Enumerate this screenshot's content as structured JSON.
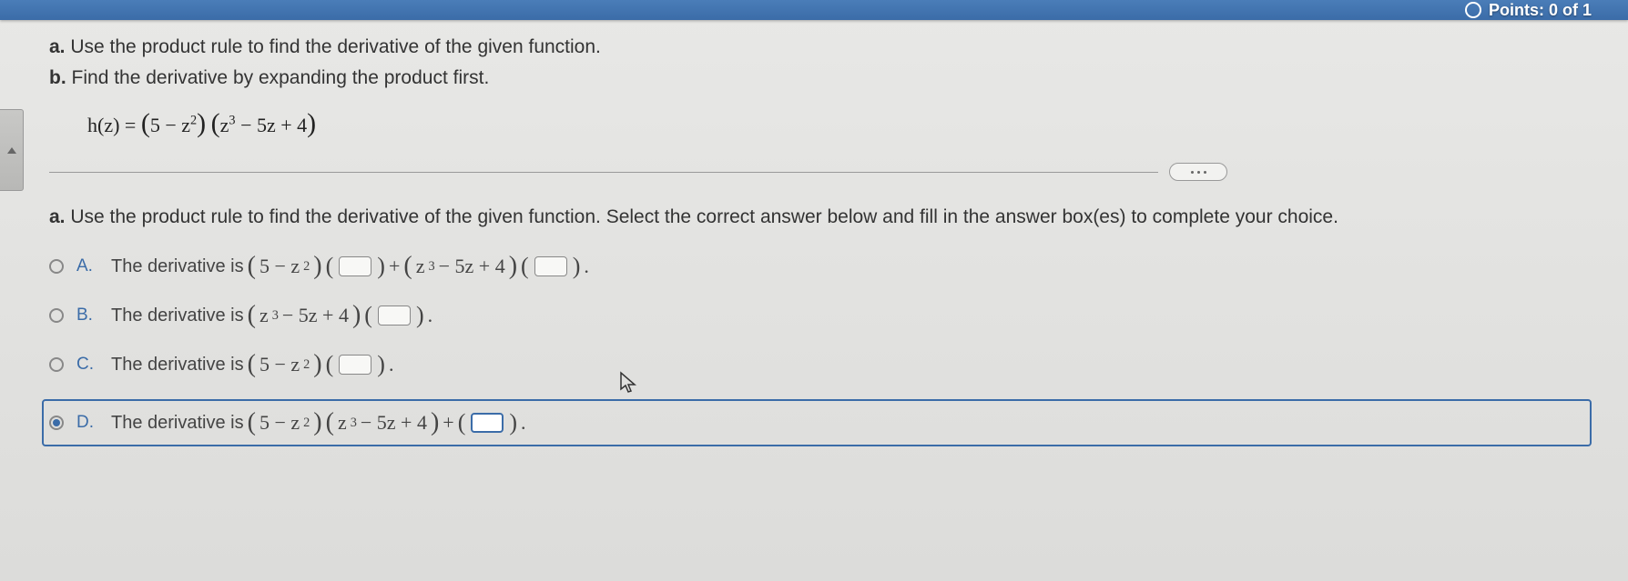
{
  "header": {
    "points_label": "Points: 0 of 1"
  },
  "question": {
    "instr_a_prefix": "a.",
    "instr_a": "Use the product rule to find the derivative of the given function.",
    "instr_b_prefix": "b.",
    "instr_b": "Find the derivative by expanding the product first.",
    "equation_lhs": "h(z) = ",
    "equation_factor1": "5 − z",
    "equation_factor1_exp": "2",
    "equation_factor2a": "z",
    "equation_factor2a_exp": "3",
    "equation_factor2b": " − 5z + 4"
  },
  "subprompt": {
    "prefix": "a.",
    "text": "Use the product rule to find the derivative of the given function. Select the correct answer below and fill in the answer box(es) to complete your choice."
  },
  "choices": {
    "A": {
      "letter": "A.",
      "lead": "The derivative is "
    },
    "B": {
      "letter": "B.",
      "lead": "The derivative is "
    },
    "C": {
      "letter": "C.",
      "lead": "The derivative is "
    },
    "D": {
      "letter": "D.",
      "lead": "The derivative is "
    }
  },
  "selected": "D"
}
